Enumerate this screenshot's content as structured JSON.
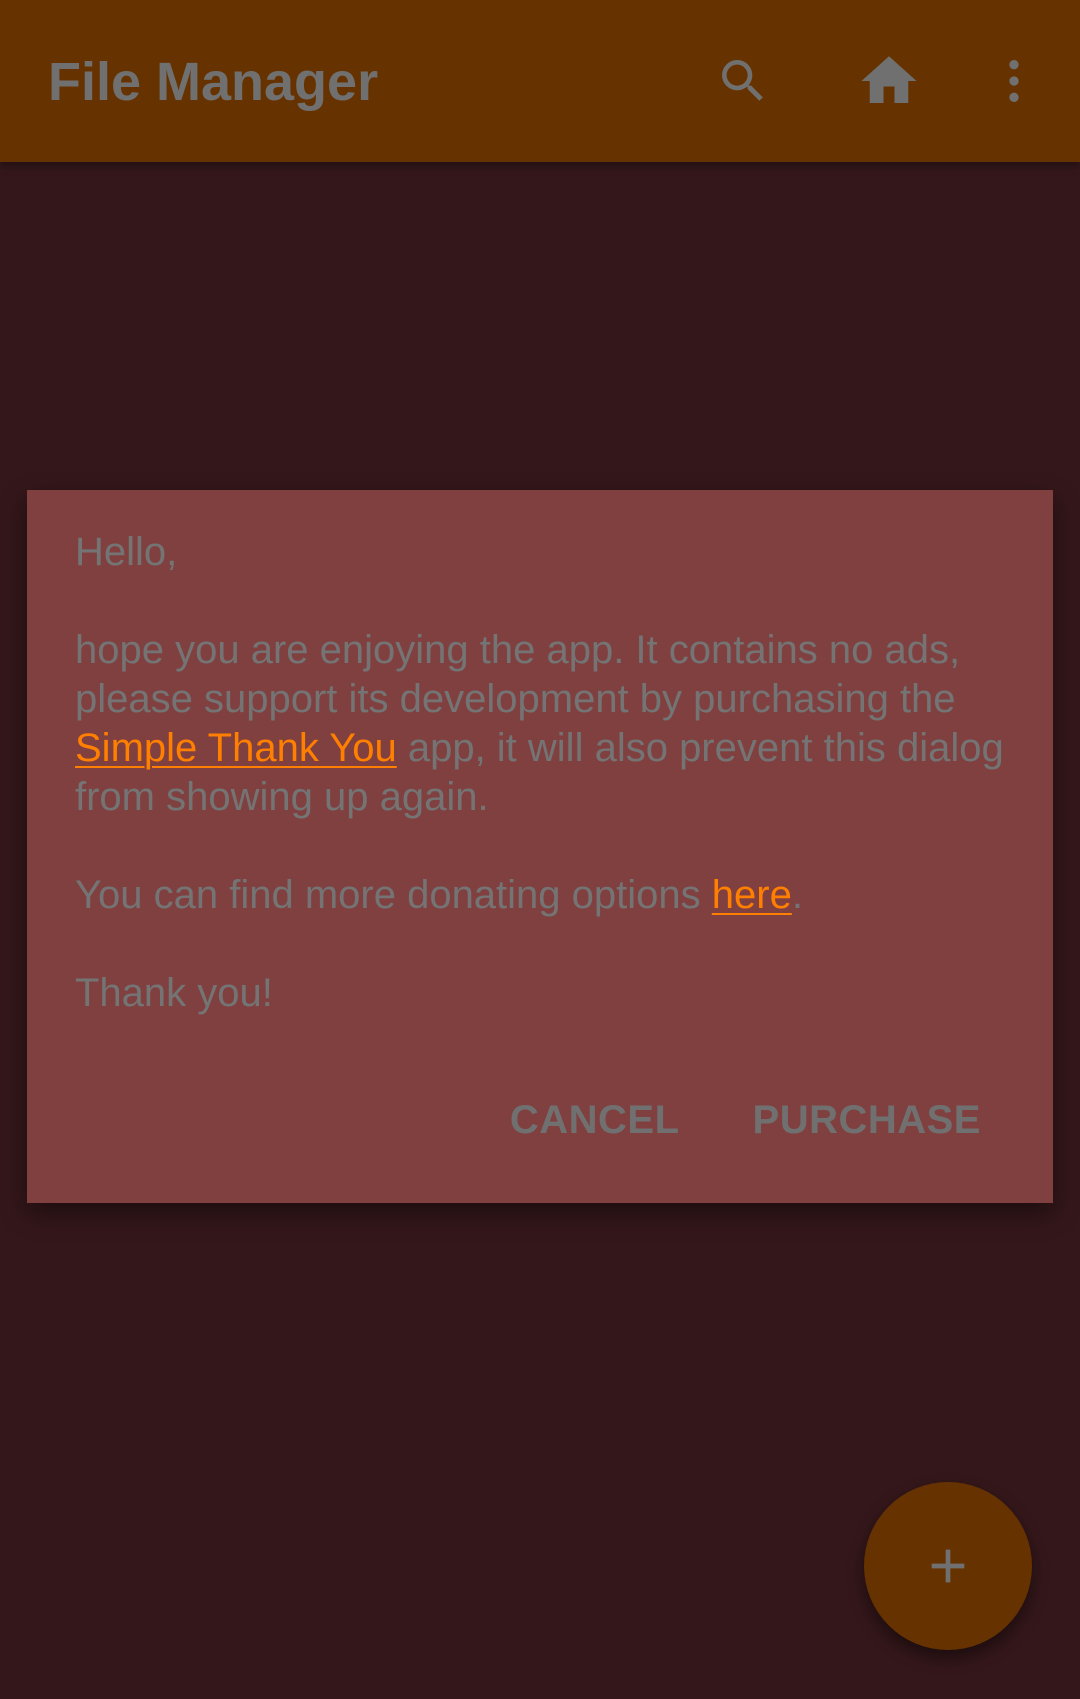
{
  "appbar": {
    "title": "File Manager",
    "icons": [
      "search-icon",
      "home-icon",
      "more-vert-icon"
    ]
  },
  "dialog": {
    "greeting": "Hello,",
    "body_line_1_pre": "hope you are enjoying the app. It contains no ads, please support its development by purchasing the ",
    "body_link_1": "Simple Thank You",
    "body_line_1_post": " app, it will also prevent this dialog from showing up again.",
    "body_line_2_pre": "You can find more donating options ",
    "body_link_2": "here",
    "body_line_2_post": ".",
    "closing": "Thank you!",
    "cancel_label": "CANCEL",
    "purchase_label": "PURCHASE"
  },
  "fab": {
    "icon": "plus-icon"
  },
  "colors": {
    "background": "#34171a",
    "appbar": "#663300",
    "dialog": "#804040",
    "link": "#ff7f00",
    "text": "#747474"
  }
}
